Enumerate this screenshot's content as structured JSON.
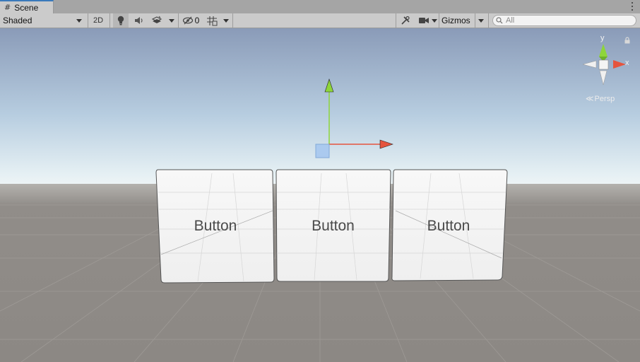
{
  "tab": {
    "title": "Scene"
  },
  "toolbar": {
    "shading_mode": "Shaded",
    "mode_2d": "2D",
    "hidden_count": "0",
    "gizmos": "Gizmos",
    "search_placeholder": "All"
  },
  "scene": {
    "ui_buttons": [
      {
        "label": "Button"
      },
      {
        "label": "Button"
      },
      {
        "label": "Button"
      }
    ],
    "orientation_gizmo": {
      "y_label": "y",
      "x_label": "x",
      "projection": "Persp"
    }
  },
  "colors": {
    "sky_top": "#8a9bb8",
    "sky_horizon": "#eef4f6",
    "ground": "#8c8884",
    "x_axis": "#e5543e",
    "y_axis": "#8ed53a",
    "tab_accent": "#3a79bb"
  }
}
